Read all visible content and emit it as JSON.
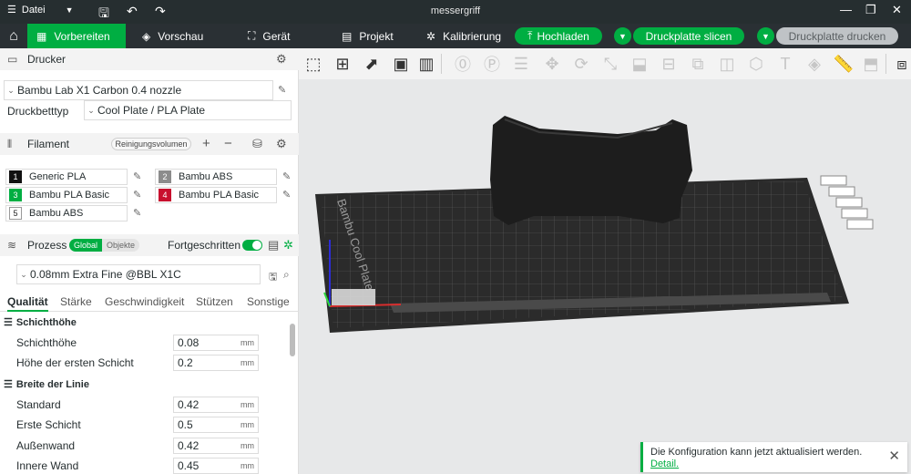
{
  "titlebar": {
    "menu_label": "Datei",
    "title": "messergriff"
  },
  "nav": {
    "tabs": [
      "Vorbereiten",
      "Vorschau",
      "Gerät",
      "Projekt",
      "Kalibrierung"
    ],
    "upload_label": "Hochladen",
    "slice_label": "Druckplatte slicen",
    "print_label": "Druckplatte drucken"
  },
  "printer": {
    "section_title": "Drucker",
    "model": "Bambu Lab X1 Carbon 0.4 nozzle",
    "bed_type_label": "Druckbetttyp",
    "bed_type": "Cool Plate / PLA Plate"
  },
  "filament": {
    "section_title": "Filament",
    "purge_label": "Reinigungsvolumen",
    "items": [
      {
        "num": "1",
        "name": "Generic PLA",
        "color": "#111111"
      },
      {
        "num": "2",
        "name": "Bambu ABS",
        "color": "#8c8c8c"
      },
      {
        "num": "3",
        "name": "Bambu PLA Basic",
        "color": "#00ae42"
      },
      {
        "num": "4",
        "name": "Bambu PLA Basic",
        "color": "#c8102e"
      },
      {
        "num": "5",
        "name": "Bambu ABS",
        "color": "#ffffff"
      }
    ]
  },
  "process": {
    "section_title": "Prozess",
    "scope_global": "Global",
    "scope_objects": "Objekte",
    "advanced_label": "Fortgeschritten",
    "profile": "0.08mm Extra Fine @BBL X1C",
    "tabs": [
      "Qualität",
      "Stärke",
      "Geschwindigkeit",
      "Stützen",
      "Sonstige"
    ],
    "groups": [
      {
        "title": "Schichthöhe",
        "rows": [
          {
            "label": "Schichthöhe",
            "value": "0.08",
            "unit": "mm"
          },
          {
            "label": "Höhe der ersten Schicht",
            "value": "0.2",
            "unit": "mm"
          }
        ]
      },
      {
        "title": "Breite der Linie",
        "rows": [
          {
            "label": "Standard",
            "value": "0.42",
            "unit": "mm"
          },
          {
            "label": "Erste Schicht",
            "value": "0.5",
            "unit": "mm"
          },
          {
            "label": "Außenwand",
            "value": "0.42",
            "unit": "mm"
          },
          {
            "label": "Innere Wand",
            "value": "0.45",
            "unit": "mm"
          }
        ]
      }
    ]
  },
  "plate": {
    "text": "Bambu Cool Plate"
  },
  "notification": {
    "message": "Die Konfiguration kann jetzt aktualisiert werden.",
    "link": "Detail."
  },
  "colors": {
    "accent": "#00ae42",
    "titlebar": "#262e30",
    "viewport_bg": "#e7e8e9"
  }
}
